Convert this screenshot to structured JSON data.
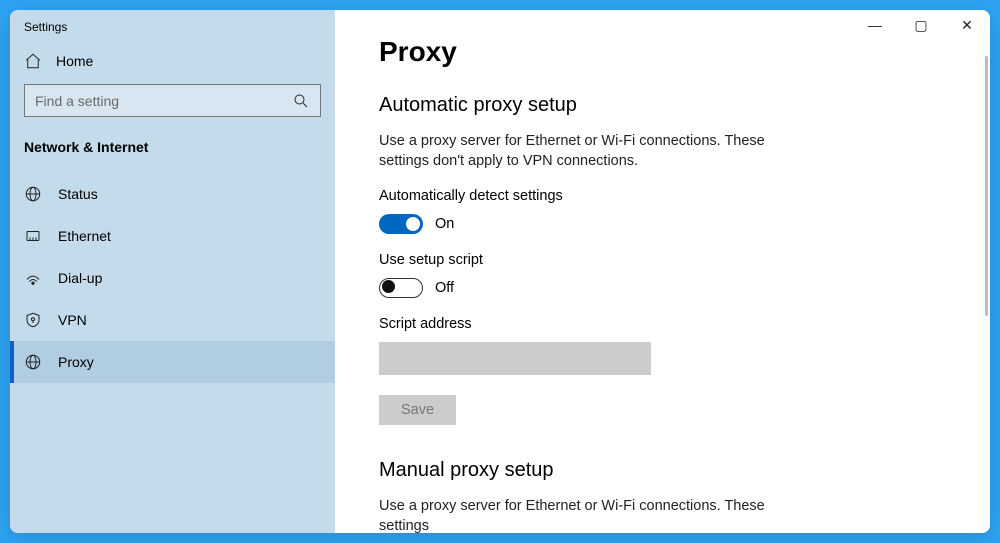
{
  "window": {
    "title": "Settings"
  },
  "home": {
    "label": "Home"
  },
  "search": {
    "placeholder": "Find a setting"
  },
  "category": {
    "label": "Network & Internet"
  },
  "nav": {
    "items": [
      {
        "label": "Status"
      },
      {
        "label": "Ethernet"
      },
      {
        "label": "Dial-up"
      },
      {
        "label": "VPN"
      },
      {
        "label": "Proxy"
      }
    ]
  },
  "page": {
    "title": "Proxy",
    "auto": {
      "heading": "Automatic proxy setup",
      "desc": "Use a proxy server for Ethernet or Wi-Fi connections. These settings don't apply to VPN connections.",
      "detect_label": "Automatically detect settings",
      "detect_state": "On",
      "script_label": "Use setup script",
      "script_state": "Off",
      "address_label": "Script address",
      "address_value": "",
      "save_label": "Save"
    },
    "manual": {
      "heading": "Manual proxy setup",
      "desc": "Use a proxy server for Ethernet or Wi-Fi connections. These settings"
    }
  },
  "controls": {
    "min": "—",
    "max": "▢",
    "close": "✕"
  }
}
